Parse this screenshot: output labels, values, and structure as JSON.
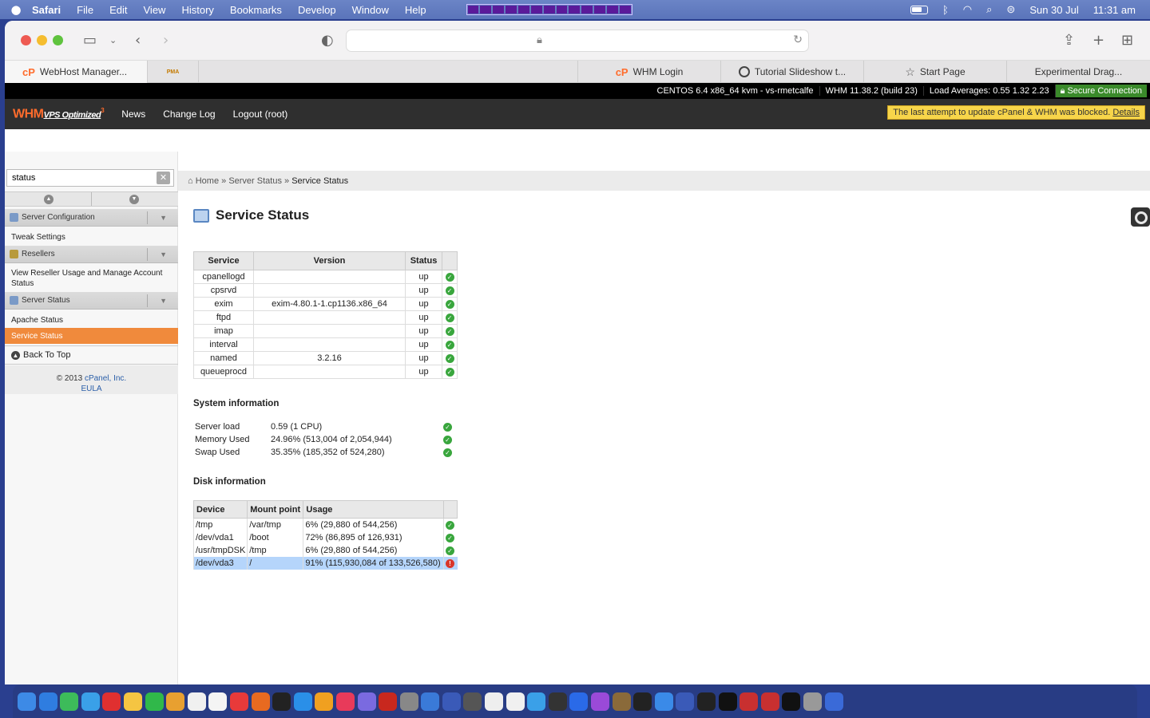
{
  "menubar": {
    "apple": "",
    "items": [
      "Safari",
      "File",
      "Edit",
      "View",
      "History",
      "Bookmarks",
      "Develop",
      "Window",
      "Help"
    ],
    "date": "Sun 30 Jul",
    "time": "11:31 am"
  },
  "tabs": [
    {
      "label": "WebHost Manager...",
      "icon": "cP"
    },
    {
      "label": "",
      "icon": "PMA"
    },
    {
      "label": "",
      "icon": ""
    },
    {
      "label": "WHM Login",
      "icon": "cP"
    },
    {
      "label": "Tutorial Slideshow t...",
      "icon": "github-icon"
    },
    {
      "label": "Start Page",
      "icon": "star-icon"
    },
    {
      "label": "Experimental Drag...",
      "icon": ""
    }
  ],
  "statusstrip": {
    "os": "CENTOS 6.4 x86_64 kvm - vs-rmetcalfe",
    "whm": "WHM 11.38.2 (build 23)",
    "load": "Load Averages: 0.55 1.32 2.23",
    "secure": "Secure Connection"
  },
  "whmnav": {
    "logo": "WHM",
    "logo_sub": "VPS Optimized",
    "logo_num": "3",
    "items": [
      "News",
      "Change Log",
      "Logout (root)"
    ],
    "alert_text": "The last attempt to update cPanel & WHM was blocked.",
    "alert_link": "Details"
  },
  "sidebar": {
    "search_value": "status",
    "clear": "✕",
    "categories": [
      {
        "label": "Server Configuration"
      },
      {
        "label": "Resellers"
      },
      {
        "label": "Server Status"
      }
    ],
    "items": {
      "tweak": "Tweak Settings",
      "reseller_usage": "View Reseller Usage and Manage Account Status",
      "apache": "Apache Status",
      "service": "Service Status"
    },
    "back_top": "Back To Top",
    "copyright": "© 2013",
    "company": "cPanel, Inc.",
    "eula": "EULA"
  },
  "breadcrumb": {
    "home": "Home",
    "sep": "»",
    "server_status": "Server Status",
    "current": "Service Status"
  },
  "page_title": "Service Status",
  "service_table": {
    "headers": [
      "Service",
      "Version",
      "Status"
    ],
    "rows": [
      {
        "service": "cpanellogd",
        "version": "",
        "status": "up"
      },
      {
        "service": "cpsrvd",
        "version": "",
        "status": "up"
      },
      {
        "service": "exim",
        "version": "exim-4.80.1-1.cp1136.x86_64",
        "status": "up"
      },
      {
        "service": "ftpd",
        "version": "",
        "status": "up"
      },
      {
        "service": "imap",
        "version": "",
        "status": "up"
      },
      {
        "service": "interval",
        "version": "",
        "status": "up"
      },
      {
        "service": "named",
        "version": "3.2.16",
        "status": "up"
      },
      {
        "service": "queueprocd",
        "version": "",
        "status": "up"
      }
    ]
  },
  "system_info": {
    "title": "System information",
    "rows": [
      {
        "label": "Server load",
        "value": "0.59 (1 CPU)"
      },
      {
        "label": "Memory Used",
        "value": "24.96% (513,004 of 2,054,944)"
      },
      {
        "label": "Swap Used",
        "value": "35.35% (185,352 of 524,280)"
      }
    ]
  },
  "disk_info": {
    "title": "Disk information",
    "headers": [
      "Device",
      "Mount point",
      "Usage"
    ],
    "rows": [
      {
        "device": "/tmp",
        "mount": "/var/tmp",
        "usage": "6% (29,880 of 544,256)",
        "ok": true
      },
      {
        "device": "/dev/vda1",
        "mount": "/boot",
        "usage": "72% (86,895 of 126,931)",
        "ok": true
      },
      {
        "device": "/usr/tmpDSK",
        "mount": "/tmp",
        "usage": "6% (29,880 of 544,256)",
        "ok": true
      },
      {
        "device": "/dev/vda3",
        "mount": "/",
        "usage": "91% (115,930,084 of 133,526,580)",
        "ok": false
      }
    ]
  },
  "colors": {
    "accent": "#f08a3c",
    "ok": "#39a63d",
    "bad": "#d9362a"
  }
}
